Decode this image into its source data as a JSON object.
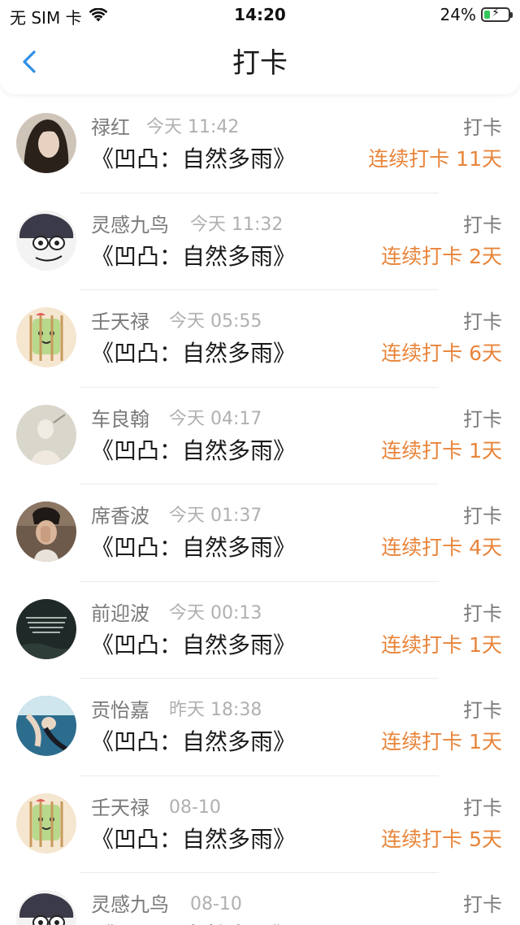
{
  "status_bar": {
    "carrier": "无 SIM 卡",
    "time": "14:20",
    "battery_percent": "24%",
    "battery_level": 0.24
  },
  "nav": {
    "title": "打卡"
  },
  "rows": [
    {
      "name": "禄红",
      "time": "今天 11:42",
      "title": "《凹凸：自然多雨》",
      "action": "打卡",
      "streak": "连续打卡 11天"
    },
    {
      "name": "灵感九鸟",
      "time": "今天 11:32",
      "title": "《凹凸：自然多雨》",
      "action": "打卡",
      "streak": "连续打卡 2天"
    },
    {
      "name": "壬天禄",
      "time": "今天 05:55",
      "title": "《凹凸：自然多雨》",
      "action": "打卡",
      "streak": "连续打卡 6天"
    },
    {
      "name": "车良翰",
      "time": "今天 04:17",
      "title": "《凹凸：自然多雨》",
      "action": "打卡",
      "streak": "连续打卡 1天"
    },
    {
      "name": "席香波",
      "time": "今天 01:37",
      "title": "《凹凸：自然多雨》",
      "action": "打卡",
      "streak": "连续打卡 4天"
    },
    {
      "name": "前迎波",
      "time": "今天 00:13",
      "title": "《凹凸：自然多雨》",
      "action": "打卡",
      "streak": "连续打卡 1天"
    },
    {
      "name": "贡怡嘉",
      "time": "昨天 18:38",
      "title": "《凹凸：自然多雨》",
      "action": "打卡",
      "streak": "连续打卡 1天"
    },
    {
      "name": "壬天禄",
      "time": "08-10",
      "title": "《凹凸：自然多雨》",
      "action": "打卡",
      "streak": "连续打卡 5天"
    },
    {
      "name": "灵感九鸟",
      "time": "08-10",
      "title": "《凹凸：自然多雨》",
      "action": "打卡",
      "streak": ""
    }
  ],
  "colors": {
    "accent_orange": "#e8843a",
    "back_blue": "#2f8fe6",
    "name_gray": "#7a7a7a",
    "time_gray": "#b0b0b0"
  }
}
